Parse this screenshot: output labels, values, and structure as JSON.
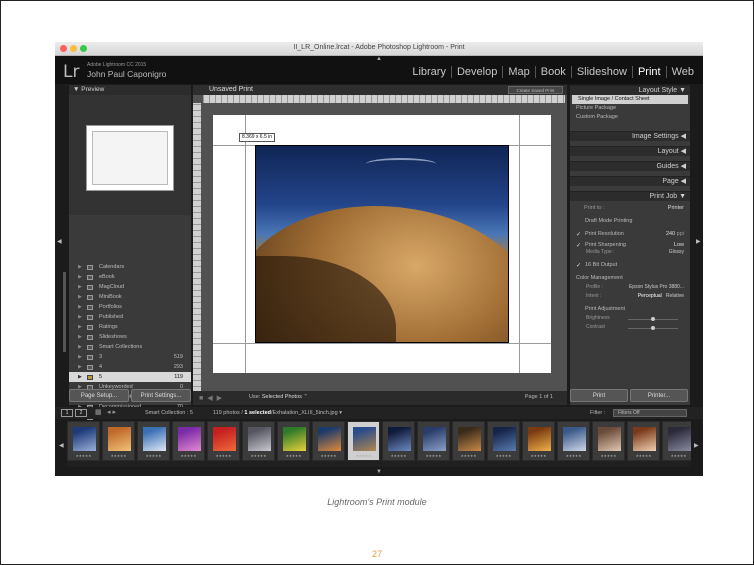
{
  "window": {
    "title": "II_LR_Online.lrcat - Adobe Photoshop Lightroom - Print"
  },
  "identity": {
    "product": "Adobe Lightroom CC 2015",
    "name": "John Paul Caponigro",
    "logo": "Lr"
  },
  "modules": [
    "Library",
    "Develop",
    "Map",
    "Book",
    "Slideshow",
    "Print",
    "Web"
  ],
  "active_module": "Print",
  "left_panel": {
    "preview_label": "Preview",
    "collections": [
      {
        "label": "Calendars",
        "count": ""
      },
      {
        "label": "eBook",
        "count": ""
      },
      {
        "label": "MagCloud",
        "count": ""
      },
      {
        "label": "MiniBook",
        "count": ""
      },
      {
        "label": "Portfolios",
        "count": ""
      },
      {
        "label": "Published",
        "count": ""
      },
      {
        "label": "Ratings",
        "count": ""
      },
      {
        "label": "Slideshows",
        "count": ""
      },
      {
        "label": "Smart Collections",
        "count": ""
      },
      {
        "label": "3",
        "count": "519"
      },
      {
        "label": "4",
        "count": "293"
      },
      {
        "label": "5",
        "count": "119"
      },
      {
        "label": "Unkeyworded",
        "count": "0"
      },
      {
        "label": "Unsaved Metadata",
        "count": "953"
      },
      {
        "label": "Decommissioned",
        "count": "70"
      },
      {
        "label": "Epson Video",
        "count": "52"
      }
    ],
    "selected_collection_index": 11,
    "page_setup_label": "Page Setup...",
    "print_settings_label": "Print Settings..."
  },
  "center": {
    "title": "Unsaved Print",
    "create_saved_label": "Create Saved Print",
    "dimension_label": "8.369 x 6.5 in",
    "use_label": "Use:",
    "use_value": "Selected Photos",
    "page_label": "Page 1 of 1"
  },
  "right_panel": {
    "layout_style_label": "Layout Style",
    "layout_options": [
      "Single Image / Contact Sheet",
      "Picture Package",
      "Custom Package"
    ],
    "sections": [
      "Image Settings",
      "Layout",
      "Guides",
      "Page",
      "Print Job"
    ],
    "print_to_label": "Print to :",
    "print_to_value": "Printer",
    "draft_mode": "Draft Mode Printing",
    "print_resolution_label": "Print Resolution",
    "print_resolution_value": "240",
    "print_resolution_unit": "ppi",
    "print_sharpening_label": "Print Sharpening",
    "print_sharpening_value": "Low",
    "media_type_label": "Media Type :",
    "media_type_value": "Glossy",
    "bit_output_label": "16 Bit Output",
    "color_management_label": "Color Management",
    "profile_label": "Profile :",
    "profile_value": "Epson Stylus Pro 3880...",
    "intent_label": "Intent :",
    "intent_perceptual": "Perceptual",
    "intent_relative": "Relative",
    "print_adjustment_label": "Print Adjustment",
    "brightness_label": "Brightness",
    "contrast_label": "Contrast",
    "print_button": "Print",
    "printer_button": "Printer..."
  },
  "filmstrip": {
    "page_buttons": [
      "1",
      "2"
    ],
    "source": "Smart Collection : 5",
    "count_prefix": "119 photos /",
    "count_selected": "1 selected",
    "count_file": "/Exhalation_XLIII_5inch.jpg",
    "filter_label": "Filter :",
    "filter_value": "Filters Off",
    "thumb_colors": [
      [
        "#1d3a7a",
        "#9ab0d8"
      ],
      [
        "#c06a2a",
        "#f1c27a"
      ],
      [
        "#3b6fb6",
        "#dfe8f5"
      ],
      [
        "#7a2aa6",
        "#e28ad0"
      ],
      [
        "#c32020",
        "#f06a3a"
      ],
      [
        "#555560",
        "#c8c8d0"
      ],
      [
        "#2f7a2a",
        "#e8d23a"
      ],
      [
        "#1c3b6b",
        "#e08a3a"
      ],
      [
        "#2a4c8c",
        "#b2874e"
      ],
      [
        "#101a3a",
        "#6a8ac0"
      ],
      [
        "#2a3d6a",
        "#8aa0c8"
      ],
      [
        "#3a2a1a",
        "#c78a4a"
      ],
      [
        "#15254a",
        "#5a7ab0"
      ],
      [
        "#7a3a10",
        "#f0b04a"
      ],
      [
        "#3a5a8a",
        "#d0d8e8"
      ],
      [
        "#6a4a3a",
        "#e0c8b0"
      ],
      [
        "#7a3a1a",
        "#f0d0b0"
      ],
      [
        "#2a2a3a",
        "#8a8aa0"
      ]
    ],
    "selected_index": 8
  },
  "caption": "Lightroom’s Print module",
  "page_number": "27"
}
